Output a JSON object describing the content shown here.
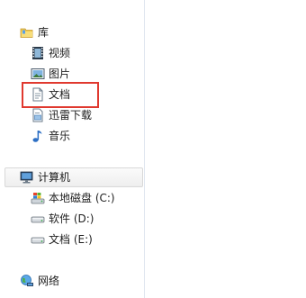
{
  "nav": {
    "library": {
      "label": "库"
    },
    "library_items": [
      {
        "label": "视频",
        "icon": "video-icon"
      },
      {
        "label": "图片",
        "icon": "picture-icon"
      },
      {
        "label": "文档",
        "icon": "document-icon"
      },
      {
        "label": "迅雷下载",
        "icon": "download-folder-icon"
      },
      {
        "label": "音乐",
        "icon": "music-note-icon"
      }
    ],
    "computer": {
      "label": "计算机"
    },
    "drives": [
      {
        "label": "本地磁盘 (C:)",
        "icon": "system-drive-icon"
      },
      {
        "label": "软件 (D:)",
        "icon": "drive-icon"
      },
      {
        "label": "文档 (E:)",
        "icon": "drive-icon"
      }
    ],
    "network": {
      "label": "网络"
    }
  },
  "colors": {
    "highlight": "#e0392f",
    "pane_border": "#dfe6ef"
  }
}
